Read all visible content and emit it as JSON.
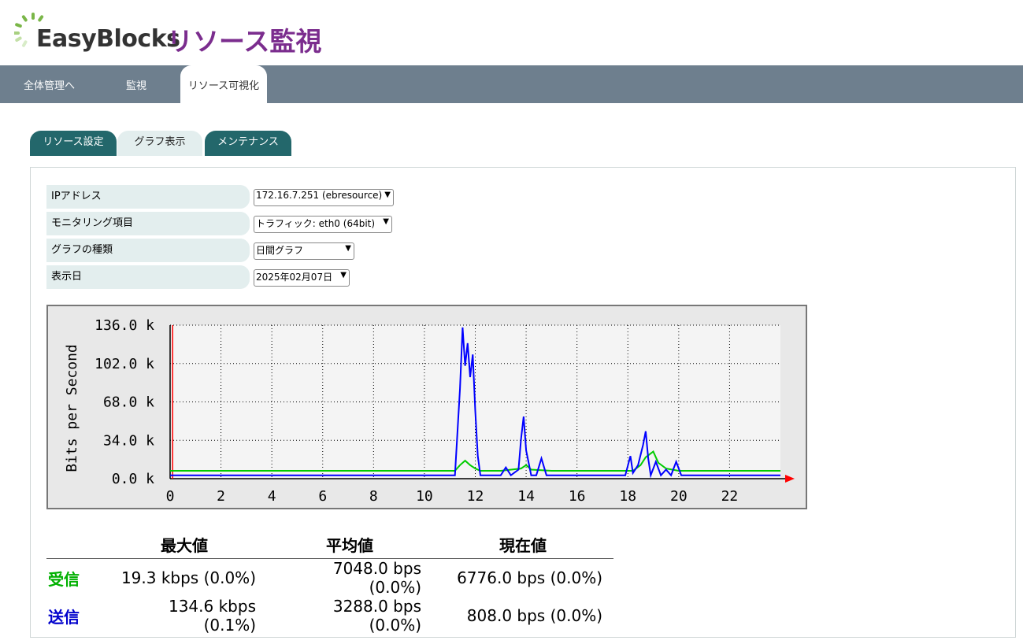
{
  "header": {
    "logo_text": "EasyBlocks",
    "app_title": "リソース監視"
  },
  "topnav": [
    "全体管理へ",
    "監視",
    "リソース可視化"
  ],
  "subtabs": [
    "リソース設定",
    "グラフ表示",
    "メンテナンス"
  ],
  "form": {
    "ip_label": "IPアドレス",
    "ip_value": "172.16.7.251 (ebresource)",
    "item_label": "モニタリング項目",
    "item_value": "トラフィック: eth0 (64bit)",
    "type_label": "グラフの種類",
    "type_value": "日間グラフ",
    "date_label": "表示日",
    "date_value": "2025年02月07日"
  },
  "chart_data": {
    "type": "line",
    "ylabel": "Bits per Second",
    "y_ticks": [
      "0.0 k",
      "34.0 k",
      "68.0 k",
      "102.0 k",
      "136.0 k"
    ],
    "x_ticks": [
      "0",
      "2",
      "4",
      "6",
      "8",
      "10",
      "12",
      "14",
      "16",
      "18",
      "20",
      "22"
    ],
    "ylim": [
      0,
      136
    ],
    "xlim": [
      0,
      24
    ],
    "grid": true,
    "series": [
      {
        "color": "#00cc00",
        "x": [
          0,
          2,
          4,
          6,
          8,
          10,
          11.2,
          11.4,
          11.6,
          11.8,
          12.0,
          12.2,
          13.0,
          13.8,
          14.0,
          14.2,
          15,
          18.2,
          18.5,
          18.7,
          19.0,
          19.2,
          19.5,
          20,
          22,
          24
        ],
        "y": [
          7,
          7,
          7,
          7,
          7,
          7,
          7,
          12,
          16,
          12,
          9,
          7,
          7,
          9,
          12,
          8,
          7,
          7,
          12,
          19,
          24,
          14,
          9,
          7,
          7,
          7
        ]
      },
      {
        "color": "#0000ff",
        "x": [
          0,
          2,
          4,
          6,
          8,
          10,
          11.2,
          11.4,
          11.5,
          11.6,
          11.7,
          11.8,
          11.9,
          12.0,
          12.1,
          12.2,
          12.5,
          13.0,
          13.2,
          13.4,
          13.7,
          13.8,
          13.9,
          14.0,
          14.2,
          14.4,
          14.6,
          14.8,
          15.0,
          17.9,
          18.1,
          18.2,
          18.4,
          18.6,
          18.7,
          18.8,
          18.9,
          19.1,
          19.3,
          19.5,
          19.7,
          19.9,
          20.1,
          22,
          24
        ],
        "y": [
          3,
          3,
          3,
          3,
          3,
          3,
          3,
          80,
          134,
          100,
          120,
          90,
          110,
          60,
          20,
          3,
          3,
          3,
          10,
          3,
          8,
          35,
          55,
          25,
          3,
          3,
          18,
          3,
          3,
          3,
          20,
          5,
          12,
          30,
          42,
          18,
          3,
          15,
          3,
          8,
          3,
          15,
          3,
          3,
          3
        ]
      }
    ]
  },
  "stats": {
    "headers": [
      "最大値",
      "平均値",
      "現在値"
    ],
    "rows": [
      {
        "label": "受信",
        "color": "#00b000",
        "values": [
          "19.3 kbps (0.0%)",
          "7048.0 bps (0.0%)",
          "6776.0 bps (0.0%)"
        ]
      },
      {
        "label": "送信",
        "color": "#0000cc",
        "values": [
          "134.6 kbps (0.1%)",
          "3288.0 bps (0.0%)",
          "808.0 bps (0.0%)"
        ]
      }
    ]
  }
}
